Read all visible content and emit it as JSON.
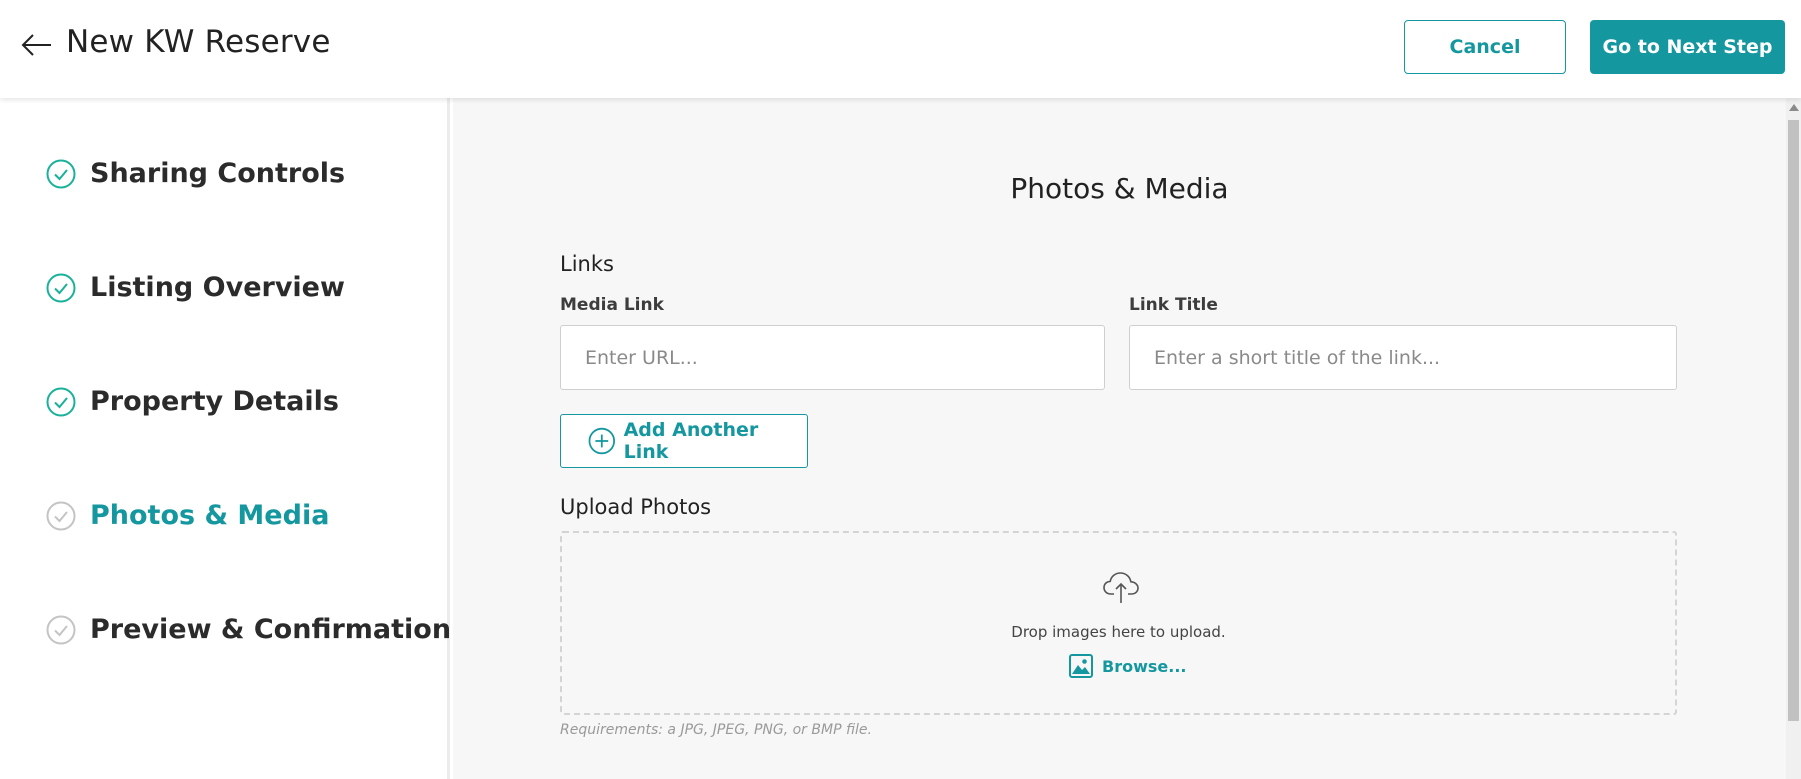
{
  "header": {
    "back_icon": "arrow-left-icon",
    "title": "New KW Reserve",
    "cancel_label": "Cancel",
    "next_label": "Go to Next Step"
  },
  "sidebar": {
    "steps": [
      {
        "label": "Sharing Controls",
        "status": "completed",
        "icon": "check-circle-icon"
      },
      {
        "label": "Listing Overview",
        "status": "completed",
        "icon": "check-circle-icon"
      },
      {
        "label": "Property Details",
        "status": "completed",
        "icon": "check-circle-icon"
      },
      {
        "label": "Photos & Media",
        "status": "active",
        "icon": "check-circle-icon"
      },
      {
        "label": "Preview & Confirmation",
        "status": "pending",
        "icon": "check-circle-icon"
      }
    ]
  },
  "main": {
    "title": "Photos & Media",
    "links": {
      "heading": "Links",
      "media_link_label": "Media Link",
      "media_link_placeholder": "Enter URL...",
      "media_link_value": "",
      "link_title_label": "Link Title",
      "link_title_placeholder": "Enter a short title of the link...",
      "link_title_value": "",
      "add_another_label": "Add Another Link",
      "add_icon": "plus-circle-icon"
    },
    "upload": {
      "heading": "Upload Photos",
      "upload_icon": "cloud-upload-icon",
      "drop_text": "Drop images here to upload.",
      "browse_label": "Browse...",
      "browse_icon": "image-icon",
      "requirements": "Requirements: a JPG, JPEG, PNG, or BMP file."
    }
  },
  "colors": {
    "accent": "#14979f",
    "step_check_completed": "#19b19a",
    "step_check_pending": "#c4c4c4",
    "main_background": "#f7f7f7"
  }
}
